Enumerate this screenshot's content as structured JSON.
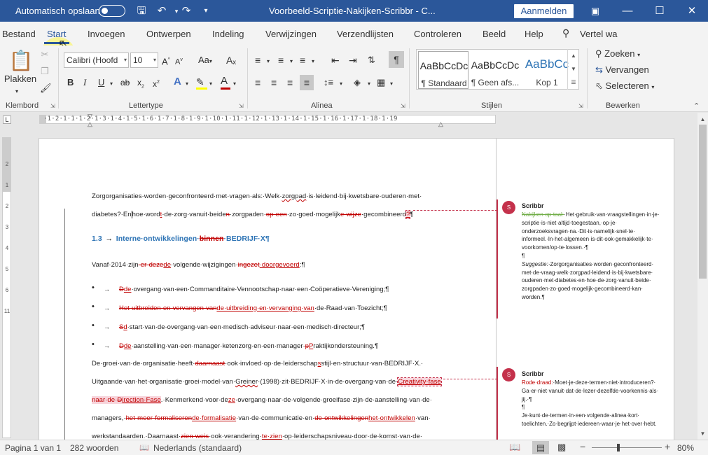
{
  "titlebar": {
    "autosave_label": "Automatisch opslaan",
    "doc_title": "Voorbeeld-Scriptie-Nakijken-Scribbr  -  C...",
    "signin_label": "Aanmelden"
  },
  "tabs": [
    "Bestand",
    "Start",
    "Invoegen",
    "Ontwerpen",
    "Indeling",
    "Verwijzingen",
    "Verzendlijsten",
    "Controleren",
    "Beeld",
    "Help"
  ],
  "tell_me": "Vertel wa",
  "ribbon": {
    "paste_label": "Plakken",
    "font_name": "Calibri (Hoofd",
    "font_size": "10",
    "case_label": "Aa",
    "styles": [
      {
        "preview": "AaBbCcDc",
        "name": "¶ Standaard"
      },
      {
        "preview": "AaBbCcDc",
        "name": "¶ Geen afs..."
      },
      {
        "preview": "AaBbCc",
        "name": "Kop 1"
      }
    ],
    "find_label": "Zoeken",
    "replace_label": "Vervangen",
    "select_label": "Selecteren",
    "groups": [
      "Klembord",
      "Lettertype",
      "Alinea",
      "Stijlen",
      "Bewerken"
    ]
  },
  "ruler": {
    "scale": "·1·2·1·1·1·2·1·3·1·4·1·5·1·6·1·7·1·8·1·9·1·10·1·11·1·12·1·13·1·14·1·15·1·16·1·17·1·18·1·19",
    "vscale": [
      "2",
      "1",
      "1",
      "1",
      "2",
      "1",
      "3",
      "1",
      "4",
      "1",
      "5",
      "1",
      "6",
      "1",
      "11",
      "1"
    ]
  },
  "document": {
    "line1": "Zorgorganisaties·worden·geconfronteerd·met·vragen·als:·Welk·",
    "line1_zorgpad": "zorgpad",
    "line1_end": "·is·leidend·bij·kwetsbare·ouderen·met·",
    "line2_a": "diabetes?·En",
    "line2_b": "hoe·word",
    "line2_ins_t": "t",
    "line2_c": "·de·zorg·vanuit·beide",
    "line2_del_n": "n",
    "line2_d": "·zorgpaden·",
    "line2_del_opeen": "op·een",
    "line2_e": "·zo·goed·mogelijk",
    "line2_del_wijze": "e·wijze",
    "line2_f": "·gecombineerd",
    "line2_ins_q": "?",
    "line2_pil": "¶",
    "heading_num": "1.3",
    "heading_arrow": "→",
    "heading_text": "Interne·ontwikkelingen·",
    "heading_del": "binnen",
    "heading_tail": "·BEDRIJF·X¶",
    "p_vanaf_a": "Vanaf·2014·zijn",
    "p_vanaf_del": "·er·deze",
    "p_vanaf_ins": "de",
    "p_vanaf_b": "·volgende·wijzigingen·",
    "p_vanaf_del2": "ingezet",
    "p_vanaf_ins2": "·doorgevoerd",
    "p_vanaf_c": ":¶",
    "bullets": [
      {
        "del": "D",
        "ins": "de",
        "text": "·overgang·van·een·Commanditaire·Vennootschap·naar·een·Coöperatieve·Vereniging;¶"
      },
      {
        "del": "Het·uitbreiden·en·vervangen·van",
        "ins": "de·uitbreiding·en·vervanging·van",
        "text": "·de·Raad·van·Toezicht;¶"
      },
      {
        "del": "S",
        "ins": "d",
        "text": "·start·van·de·overgang·van·een·medisch·adviseur·naar·een·medisch·directeur;¶"
      },
      {
        "del": "D",
        "ins": "de",
        "text": "·aanstelling·van·een·manager·ketenzorg·en·een·manager·",
        "del2": "p",
        "ins2": "P",
        "text2": "raktijkondersteuning.¶"
      }
    ],
    "bullet_char": "•",
    "bullet_arrow": "→",
    "p2_a": "De·groei·van·de·organisatie·heeft·",
    "p2_del": "daarnaast",
    "p2_b": "·ook·invloed·op·de·leiderschap",
    "p2_ins": "s",
    "p2_c": "stijl·en·structuur·van·BEDRIJF·X.·",
    "p3_a": "Uitgaande·van·het·organisatie·groei·model·van·",
    "p3_greiner": "Greiner",
    "p3_b": "·(1998)·zit·BEDRIJF·X·in·de·overgang·van·de·",
    "p3_creativity": "Creativity·fase",
    "p4_hl": "naar·de·",
    "p4_del": "D",
    "p4_ins": "irection·Fase",
    "p4_b": ".·Kenmerkend·voor·de",
    "p4_ins2": "ze",
    "p4_c": "·overgang·naar·de·volgende·groeifase·zijn·de·aanstelling·van·de·",
    "p5_a": "managers,·",
    "p5_del": "het·meer·formaliseren",
    "p5_ins": "de·formalisatie",
    "p5_b": "·van·de·communicatie·en·",
    "p5_del2": "de·ontwikkelingen",
    "p5_ins2": "het·ontwikkelen",
    "p5_c": "·van·",
    "p6_a": "werkstandaarden.·Daarnaast·",
    "p6_del": "zien·weis",
    "p6_b": "·ook·verandering·",
    "p6_ins": "te·zien",
    "p6_c": "·op·leiderschapsniveau·door·de·komst·van·de·"
  },
  "comments": [
    {
      "initial": "S",
      "author": "Scribbr",
      "label": "Nakijken·op·taal:",
      "lines": [
        "·Het·gebruik·van·vraagstellingen·in·je·",
        "scriptie·is·niet·altijd·toegestaan,·op·je·",
        "onderzoeksvragen·na.·Dit·is·namelijk·snel·te·",
        "informeel.·In·het·algemeen·is·dit·ook·gemakkelijk·te·",
        "voorkomen/op·te·lossen.·¶",
        "¶"
      ],
      "sugg_label": "Suggestie:",
      "sugg_lines": [
        "·Zorgorganisaties·worden·geconfronteerd·",
        "met·de·vraag·welk·zorgpad·leidend·is·bij·kwetsbare·",
        "ouderen·met·diabetes·en·hoe·de·zorg·vanuit·beide·",
        "zorgpaden·zo·goed·mogelijk·gecombineerd·kan·",
        "worden.¶"
      ]
    },
    {
      "initial": "S",
      "author": "Scribbr",
      "label": "Rode·draad:",
      "lines": [
        "·Moet·je·deze·termen·niet·introduceren?·",
        "Ga·er·niet·vanuit·dat·de·lezer·dezelfde·voorkennis·als·",
        "jij.·¶",
        "¶",
        "Je·kunt·de·termen·in·een·volgende·alinea·kort·",
        "toelichten.·Zo·begrijpt·iedereen·waar·je·het·over·hebt."
      ]
    }
  ],
  "status": {
    "page": "Pagina 1 van 1",
    "words": "282 woorden",
    "language": "Nederlands (standaard)",
    "zoom": "80%"
  },
  "colors": {
    "accent": "#2b579a",
    "comment": "#c4314b",
    "markup": "#c00000"
  }
}
